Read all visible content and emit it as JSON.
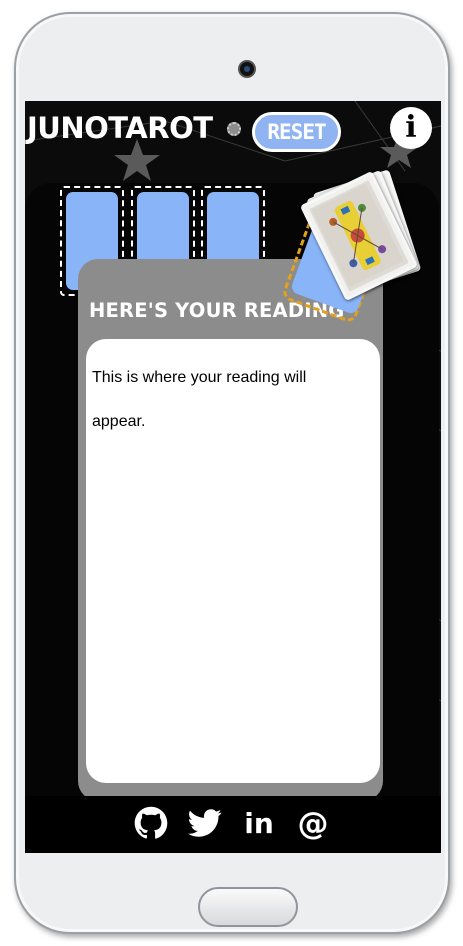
{
  "app": {
    "logo_text": "JUNOTAROT",
    "reset_label": "RESET",
    "info_label": "i"
  },
  "reading": {
    "title": "HERE'S YOUR READING",
    "text": "This is where your reading will appear."
  },
  "card_slots": [
    "slot-1",
    "slot-2",
    "slot-3"
  ],
  "social_links": [
    {
      "name": "github",
      "icon": "github-icon"
    },
    {
      "name": "twitter",
      "icon": "twitter-icon"
    },
    {
      "name": "linkedin",
      "icon": "linkedin-icon",
      "label": "in"
    },
    {
      "name": "email",
      "icon": "at-icon",
      "label": "@"
    }
  ],
  "colors": {
    "card_blue": "#8ab4f8",
    "panel_gray": "#8c8c8c",
    "deck_dash": "#e4a11b",
    "background": "#0b0b0b"
  }
}
